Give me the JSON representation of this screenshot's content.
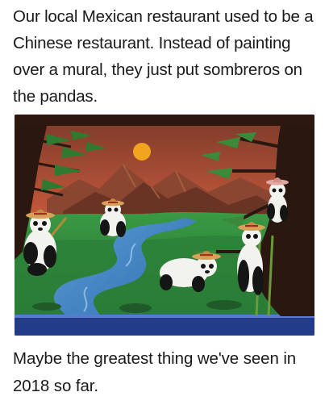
{
  "caption": {
    "top": "Our local Mexican restaurant used to be a Chinese restaurant. Instead of painting over a mural, they just put sombreros on the pandas.",
    "bottom": "Maybe the greatest thing we've seen in 2018 so far."
  },
  "colors": {
    "sky": "#c75a3a",
    "sun": "#f0a020",
    "grass": "#2f8a3c",
    "river": "#3a7fc2",
    "panda_white": "#f2f2ee",
    "panda_black": "#151515",
    "sombrero": "#d8a15a"
  }
}
